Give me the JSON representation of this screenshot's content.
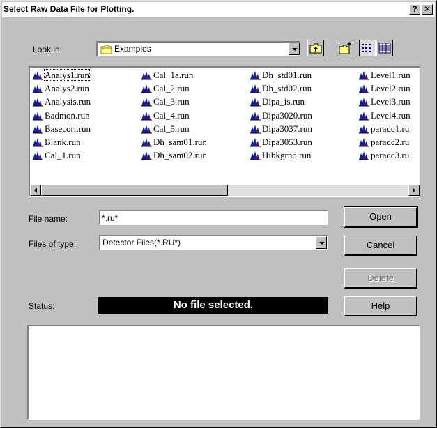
{
  "window": {
    "title": "Select Raw Data File for Plotting.",
    "help_glyph": "?",
    "close_glyph": "✕"
  },
  "look_in": {
    "label": "Look in:",
    "value": "Examples"
  },
  "file_list": {
    "columns": [
      [
        "Analys1.run",
        "Analys2.run",
        "Analysis.run",
        "Badmon.run",
        "Basecorr.run",
        "Blank.run",
        "Cal_1.run"
      ],
      [
        "Cal_1a.run",
        "Cal_2.run",
        "Cal_3.run",
        "Cal_4.run",
        "Cal_5.run",
        "Dh_sam01.run",
        "Dh_sam02.run"
      ],
      [
        "Dh_std01.run",
        "Dh_std02.run",
        "Dipa_is.run",
        "Dipa3020.run",
        "Dipa3037.run",
        "Dipa3053.run",
        "Hibkgrnd.run"
      ],
      [
        "Level1.run",
        "Level2.run",
        "Level3.run",
        "Level4.run",
        "paradc1.ru",
        "paradc2.ru",
        "paradc3.ru"
      ]
    ]
  },
  "file_name": {
    "label": "File name:",
    "value": "*.ru*"
  },
  "file_type": {
    "label": "Files of type:",
    "value": "Detector Files(*.RU*)"
  },
  "buttons": {
    "open": "Open",
    "cancel": "Cancel",
    "delete": "Delete",
    "help": "Help"
  },
  "status": {
    "label": "Status:",
    "text": "No file selected."
  },
  "colors": {
    "dialog_bg": "#c0c0c0",
    "status_bg": "#000000",
    "icon_blue": "#1020a0",
    "icon_red": "#c00000"
  }
}
